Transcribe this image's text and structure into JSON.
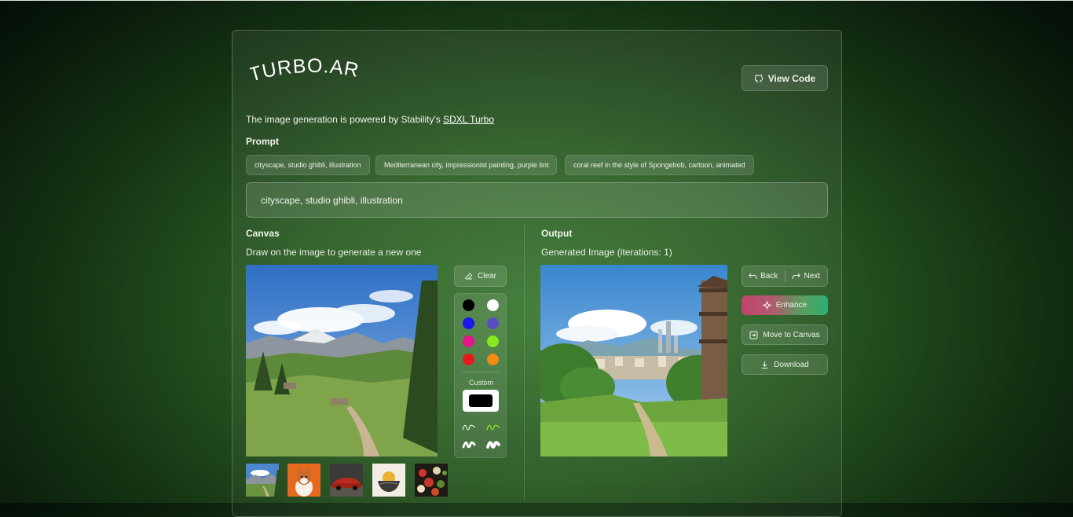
{
  "app": {
    "logo_text": "TURBO.ART",
    "view_code_label": "View Code",
    "powered_prefix": "The image generation is powered by Stability's ",
    "powered_link": "SDXL Turbo"
  },
  "prompt": {
    "label": "Prompt",
    "chips": [
      "cityscape, studio ghibli, illustration",
      "Mediterranean city, impressionist painting, purple tint",
      "coral reef in the style of Spongebob, cartoon, animated"
    ],
    "value": "cityscape, studio ghibli, illustration"
  },
  "canvas": {
    "label": "Canvas",
    "subtitle": "Draw on the image to generate a new one",
    "clear_label": "Clear",
    "colors": [
      "#000000",
      "#ffffff",
      "#1a16ee",
      "#5a4fc2",
      "#e6138f",
      "#86ea1f",
      "#e61a1a",
      "#ef8c12"
    ],
    "custom_label": "Custom",
    "custom_color": "#000000",
    "thumbnails": [
      "mountain-landscape",
      "corgi-dog",
      "red-sports-car",
      "sunset-bowl",
      "food-platter"
    ]
  },
  "output": {
    "label": "Output",
    "subtitle": "Generated Image (iterations: 1)",
    "back_label": "Back",
    "next_label": "Next",
    "enhance_label": "Enhance",
    "move_label": "Move to Canvas",
    "download_label": "Download"
  }
}
